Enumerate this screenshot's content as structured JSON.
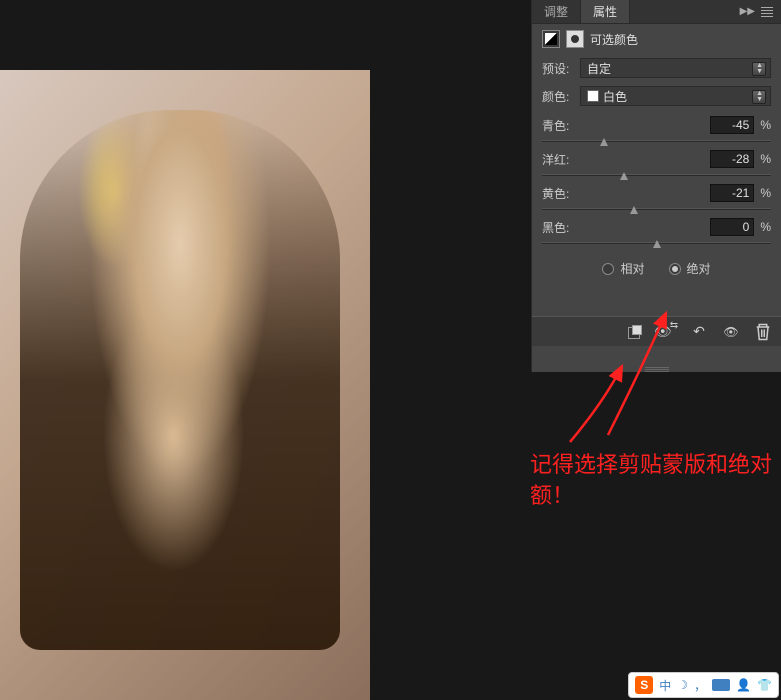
{
  "tabs": {
    "adjustments": "调整",
    "properties": "属性"
  },
  "panel_title": "可选颜色",
  "preset": {
    "label": "预设:",
    "value": "自定"
  },
  "colors": {
    "label": "颜色:",
    "value": "白色"
  },
  "sliders": {
    "cyan": {
      "label": "青色:",
      "value": "-45",
      "pos": 27
    },
    "magenta": {
      "label": "洋红:",
      "value": "-28",
      "pos": 36
    },
    "yellow": {
      "label": "黄色:",
      "value": "-21",
      "pos": 40
    },
    "black": {
      "label": "黑色:",
      "value": "0",
      "pos": 50
    }
  },
  "percent": "%",
  "method": {
    "relative": "相对",
    "absolute": "绝对"
  },
  "annotation": "记得选择剪贴蒙版和绝对额！",
  "ime": {
    "logo": "S",
    "zhong": "中",
    "moon": "☽",
    "comma": "，",
    "person": "👤",
    "shirt": "👕"
  }
}
